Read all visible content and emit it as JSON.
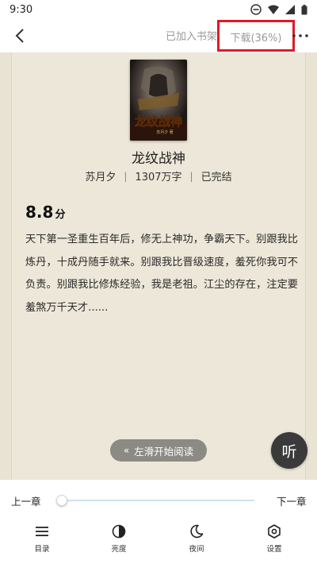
{
  "status_bar": {
    "time": "9:30"
  },
  "top_bar": {
    "back_icon": "chevron-left-icon",
    "shelf_label": "已加入书架",
    "download_label": "下载(36%)",
    "download_progress_percent": 36,
    "more_icon": "more-dots-icon",
    "highlight_color": "#e0192a"
  },
  "book": {
    "title": "龙纹战神",
    "author": "苏月夕",
    "word_count": "1307万字",
    "status": "已完结",
    "cover_title_text": "龙纹战神",
    "cover_author_text": "苏月夕 著",
    "rating_value": "8.8",
    "rating_unit": "分",
    "synopsis": "天下第一圣重生百年后，修无上神功，争霸天下。别跟我比炼丹，十成丹随手就来。别跟我比晋级速度，羞死你我可不负责。别跟我比修炼经验，我是老祖。江尘的存在，注定要羞煞万千天才......"
  },
  "reader": {
    "swipe_hint_icon": "double-chevron-left-icon",
    "swipe_hint": "左滑开始阅读",
    "listen_label": "听",
    "background_color": "#e8e3d3"
  },
  "bottom_panel": {
    "prev_chapter": "上一章",
    "next_chapter": "下一章",
    "chapter_progress": 0,
    "tools": [
      {
        "icon": "menu-list-icon",
        "label": "目录"
      },
      {
        "icon": "brightness-icon",
        "label": "亮度"
      },
      {
        "icon": "moon-icon",
        "label": "夜间"
      },
      {
        "icon": "settings-gear-icon",
        "label": "设置"
      }
    ]
  }
}
